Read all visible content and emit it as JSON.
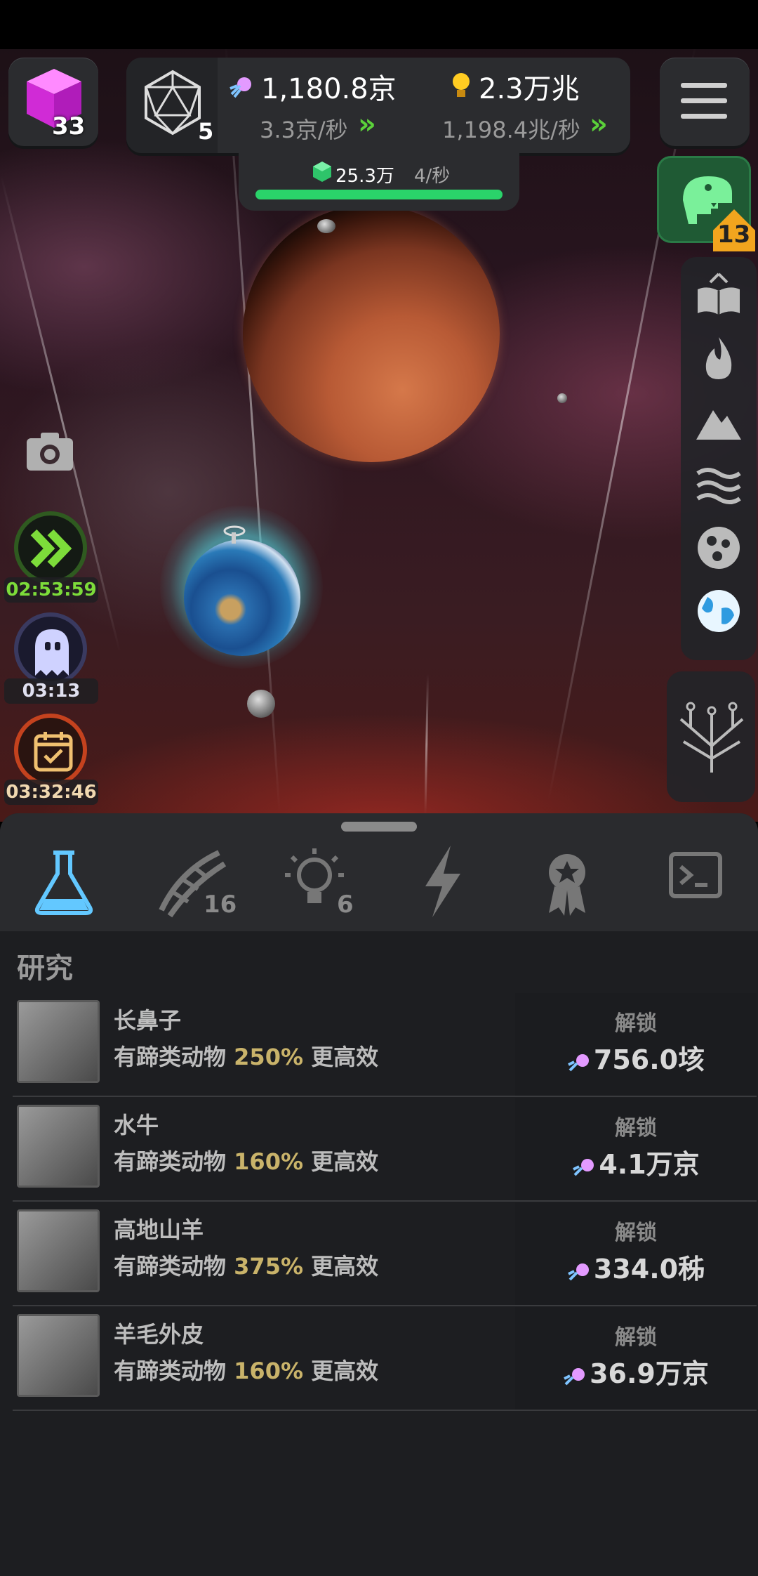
{
  "header": {
    "cube_count": "33",
    "dice_count": "5",
    "resource1": {
      "value": "1,180.8京",
      "rate": "3.3京/秒"
    },
    "resource2": {
      "value": "2.3万兆",
      "rate": "1,198.4兆/秒"
    },
    "progress": {
      "value": "25.3万",
      "rate": "4/秒",
      "fill_fraction": 1.0
    }
  },
  "dino": {
    "badge": "13"
  },
  "timers": [
    {
      "name": "speed",
      "time": "02:53:59",
      "color": "#7ddc3a"
    },
    {
      "name": "ghost",
      "time": "03:13",
      "color": "#cfcfe8"
    },
    {
      "name": "calendar",
      "time": "03:32:46",
      "color": "#f0c070"
    }
  ],
  "tabs": [
    {
      "name": "research",
      "count": ""
    },
    {
      "name": "dna",
      "count": "16"
    },
    {
      "name": "ideas",
      "count": "6"
    },
    {
      "name": "power",
      "count": ""
    },
    {
      "name": "achievements",
      "count": ""
    },
    {
      "name": "terminal",
      "count": ""
    }
  ],
  "section": {
    "title": "研究"
  },
  "research": [
    {
      "name": "长鼻子",
      "desc_prefix": "有蹄类动物 ",
      "pct": "250%",
      "desc_suffix": " 更高效",
      "unlock": "解锁",
      "cost": "756.0垓"
    },
    {
      "name": "水牛",
      "desc_prefix": "有蹄类动物 ",
      "pct": "160%",
      "desc_suffix": " 更高效",
      "unlock": "解锁",
      "cost": "4.1万京"
    },
    {
      "name": "高地山羊",
      "desc_prefix": "有蹄类动物 ",
      "pct": "375%",
      "desc_suffix": " 更高效",
      "unlock": "解锁",
      "cost": "334.0秭"
    },
    {
      "name": "羊毛外皮",
      "desc_prefix": "有蹄类动物 ",
      "pct": "160%",
      "desc_suffix": " 更高效",
      "unlock": "解锁",
      "cost": "36.9万京"
    }
  ],
  "colors": {
    "accent_green": "#5bd13a",
    "panel": "#2b2c2f",
    "gold_text": "#c9b36a"
  }
}
